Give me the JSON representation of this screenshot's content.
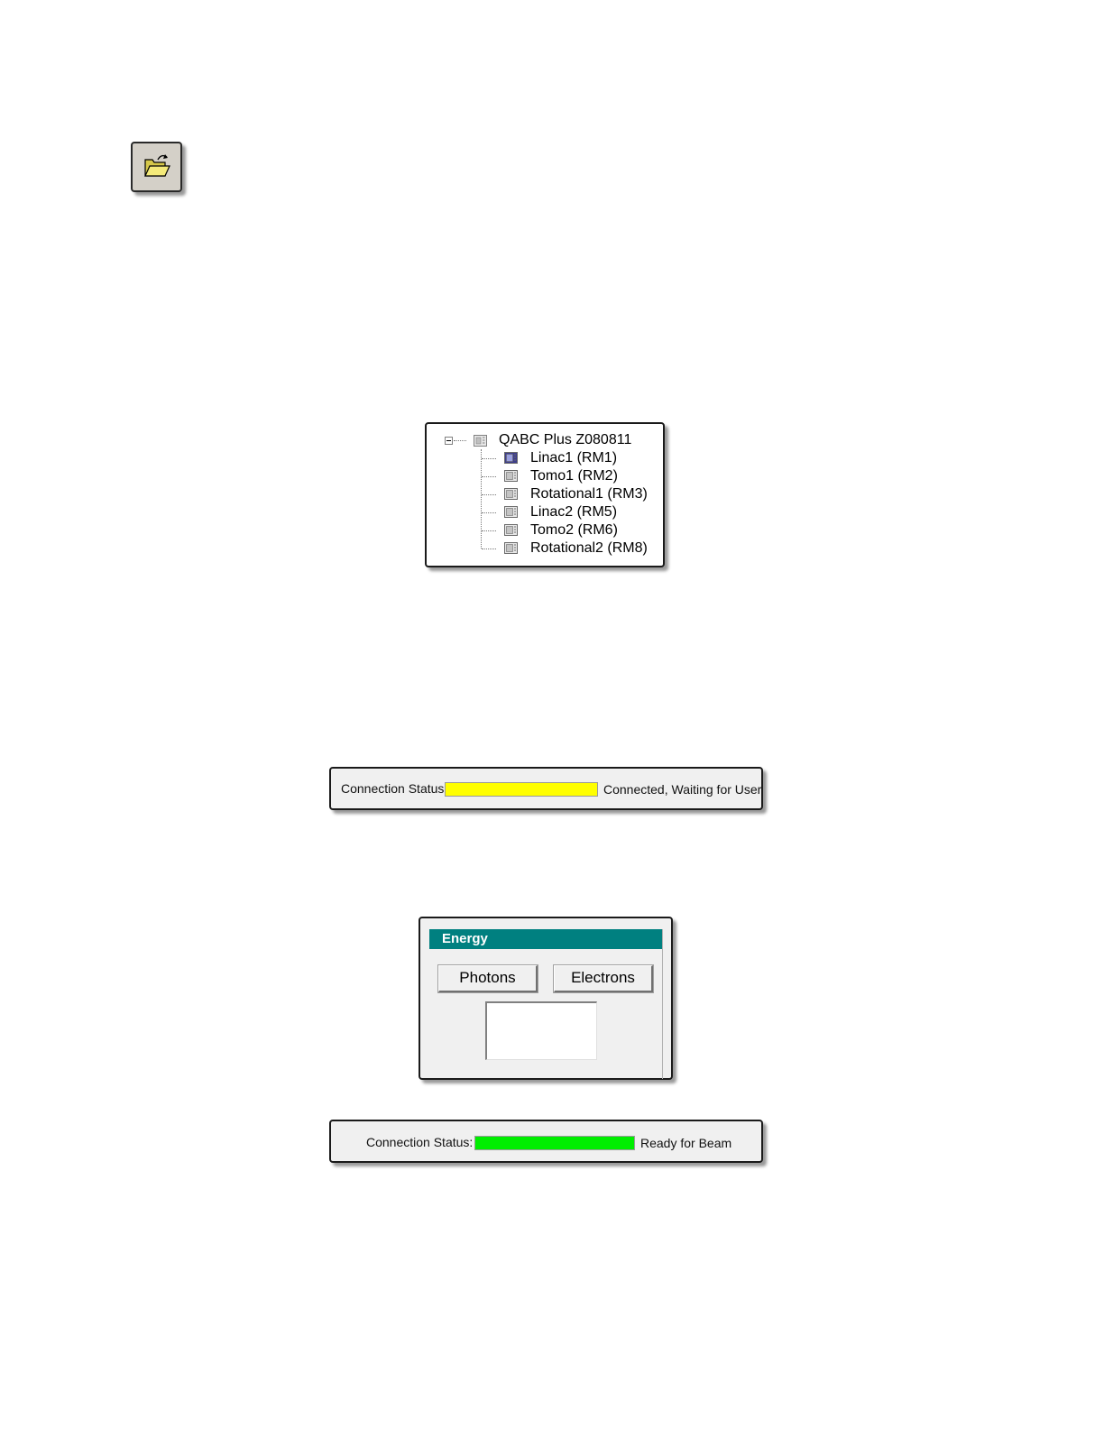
{
  "toolbar": {
    "open_button": {
      "icon": "open-folder-icon"
    }
  },
  "tree": {
    "root": {
      "label": "QABC Plus Z080811",
      "icon": "device-icon"
    },
    "items": [
      {
        "label": "Linac1 (RM1)",
        "icon": "machine-icon",
        "selected": true
      },
      {
        "label": "Tomo1 (RM2)",
        "icon": "machine-icon",
        "selected": false
      },
      {
        "label": "Rotational1 (RM3)",
        "icon": "machine-icon",
        "selected": false
      },
      {
        "label": "Linac2 (RM5)",
        "icon": "machine-icon",
        "selected": false
      },
      {
        "label": "Tomo2 (RM6)",
        "icon": "machine-icon",
        "selected": false
      },
      {
        "label": "Rotational2 (RM8)",
        "icon": "machine-icon",
        "selected": false
      }
    ]
  },
  "status_waiting": {
    "label": "Connection Status:",
    "text": "Connected, Waiting for User",
    "color": "#ffff00"
  },
  "energy": {
    "title": "Energy",
    "photons_label": "Photons",
    "electrons_label": "Electrons",
    "header_color": "#008080"
  },
  "status_ready": {
    "label": "Connection Status:",
    "text": "Ready for Beam",
    "color": "#00ee00"
  }
}
